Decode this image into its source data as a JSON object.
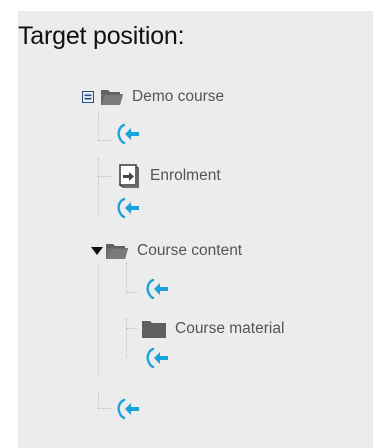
{
  "heading": "Target position:",
  "tree": {
    "root": {
      "label": "Demo course",
      "toggle": "minus-box-icon",
      "icon": "open-folder-icon"
    },
    "items": [
      {
        "type": "drop-target",
        "icon": "move-here-arrow-icon"
      },
      {
        "type": "activity",
        "label": "Enrolment",
        "icon": "enrolment-document-icon"
      },
      {
        "type": "drop-target",
        "icon": "move-here-arrow-icon"
      },
      {
        "type": "section",
        "label": "Course content",
        "toggle": "triangle-down-icon",
        "icon": "open-folder-icon",
        "children": [
          {
            "type": "drop-target",
            "icon": "move-here-arrow-icon"
          },
          {
            "type": "section",
            "label": "Course material",
            "icon": "closed-folder-icon"
          },
          {
            "type": "drop-target",
            "icon": "move-here-arrow-icon"
          }
        ]
      },
      {
        "type": "drop-target",
        "icon": "move-here-arrow-icon"
      }
    ]
  },
  "colors": {
    "panel_bg": "#ececec",
    "arrow": "#1aa3d9",
    "folder": "#606060",
    "label": "#555555",
    "toggle_box": "#2f4f85"
  }
}
